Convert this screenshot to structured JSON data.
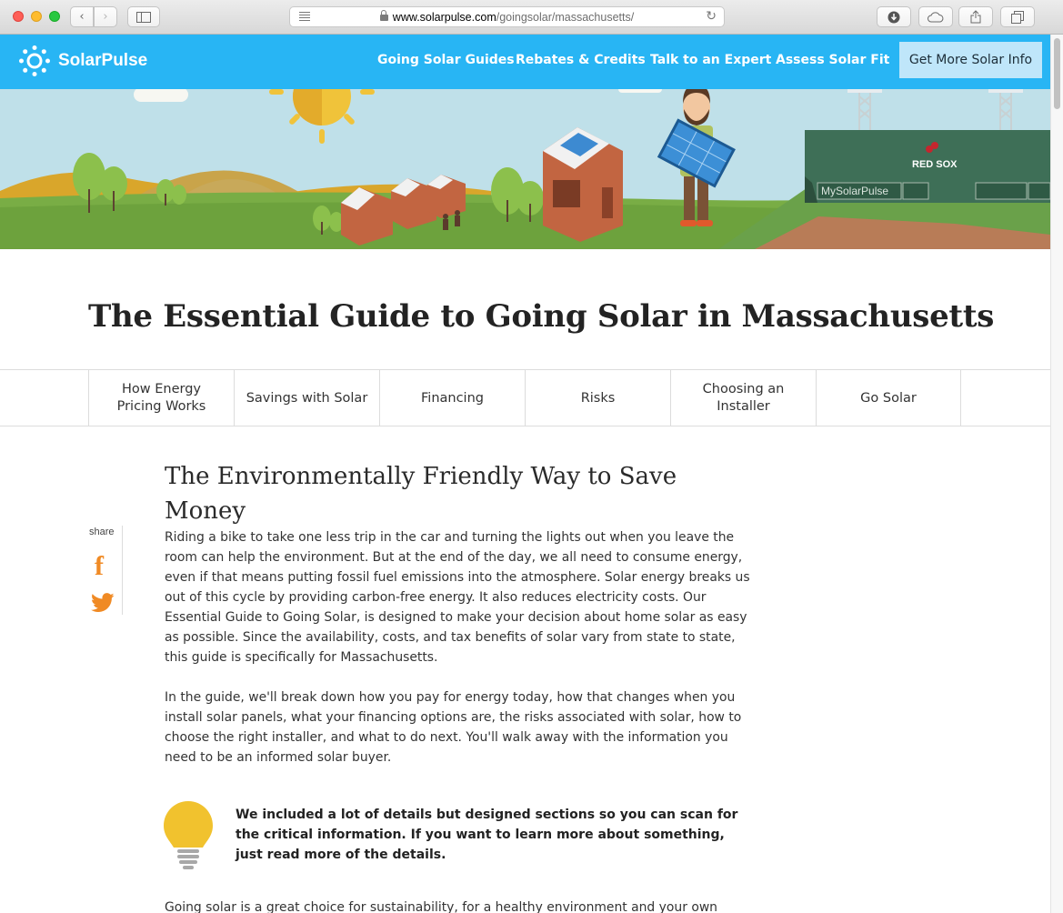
{
  "browser": {
    "url_domain": "www.solarpulse.com",
    "url_path": "/goingsolar/massachusetts/"
  },
  "site": {
    "logo_text": "SolarPulse",
    "nav": [
      {
        "label": "Going Solar Guides"
      },
      {
        "label": "Rebates & Credits"
      },
      {
        "label": "Talk to an Expert"
      },
      {
        "label": "Assess Solar Fit"
      }
    ],
    "cta_label": "Get More Solar Info"
  },
  "hero": {
    "sign_text": "RED SOX",
    "board_text": "MySolarPulse"
  },
  "page_title": "The Essential Guide to Going Solar in Massachusetts",
  "tabs": [
    {
      "label": "How Energy Pricing Works"
    },
    {
      "label": "Savings with Solar"
    },
    {
      "label": "Financing"
    },
    {
      "label": "Risks"
    },
    {
      "label": "Choosing an Installer"
    },
    {
      "label": "Go Solar"
    }
  ],
  "share": {
    "label": "share",
    "facebook_icon": "facebook-icon",
    "twitter_icon": "twitter-icon"
  },
  "article": {
    "heading": "The Environmentally Friendly Way to Save Money",
    "p1": "Riding a bike to take one less trip in the car and turning the lights out when you leave the room can help the environment. But at the end of the day, we all need to consume energy, even if that means putting fossil fuel emissions into the atmosphere. Solar energy breaks us out of this cycle by providing carbon-free energy. It also reduces electricity costs. Our Essential Guide to Going Solar, is designed to make your decision about home solar as easy as possible. Since the availability, costs, and tax benefits of solar vary from state to state, this guide is specifically for Massachusetts.",
    "p2": "In the guide, we'll break down how you pay for energy today, how that changes when you install solar panels, what your financing options are, the risks associated with solar, how to choose the right installer, and what to do next. You'll walk away with the information you need to be an informed solar buyer.",
    "tip": "We included a lot of details but designed sections so you can scan for the critical information. If you want to learn more about something, just read more of the details.",
    "p3": "Going solar is a great choice for sustainability, for a healthy environment and your own"
  },
  "colors": {
    "nav_bg": "#28b5f4",
    "cta_bg": "#bfe6fa",
    "accent_orange": "#f08a24",
    "bulb_yellow": "#f1c22e"
  }
}
